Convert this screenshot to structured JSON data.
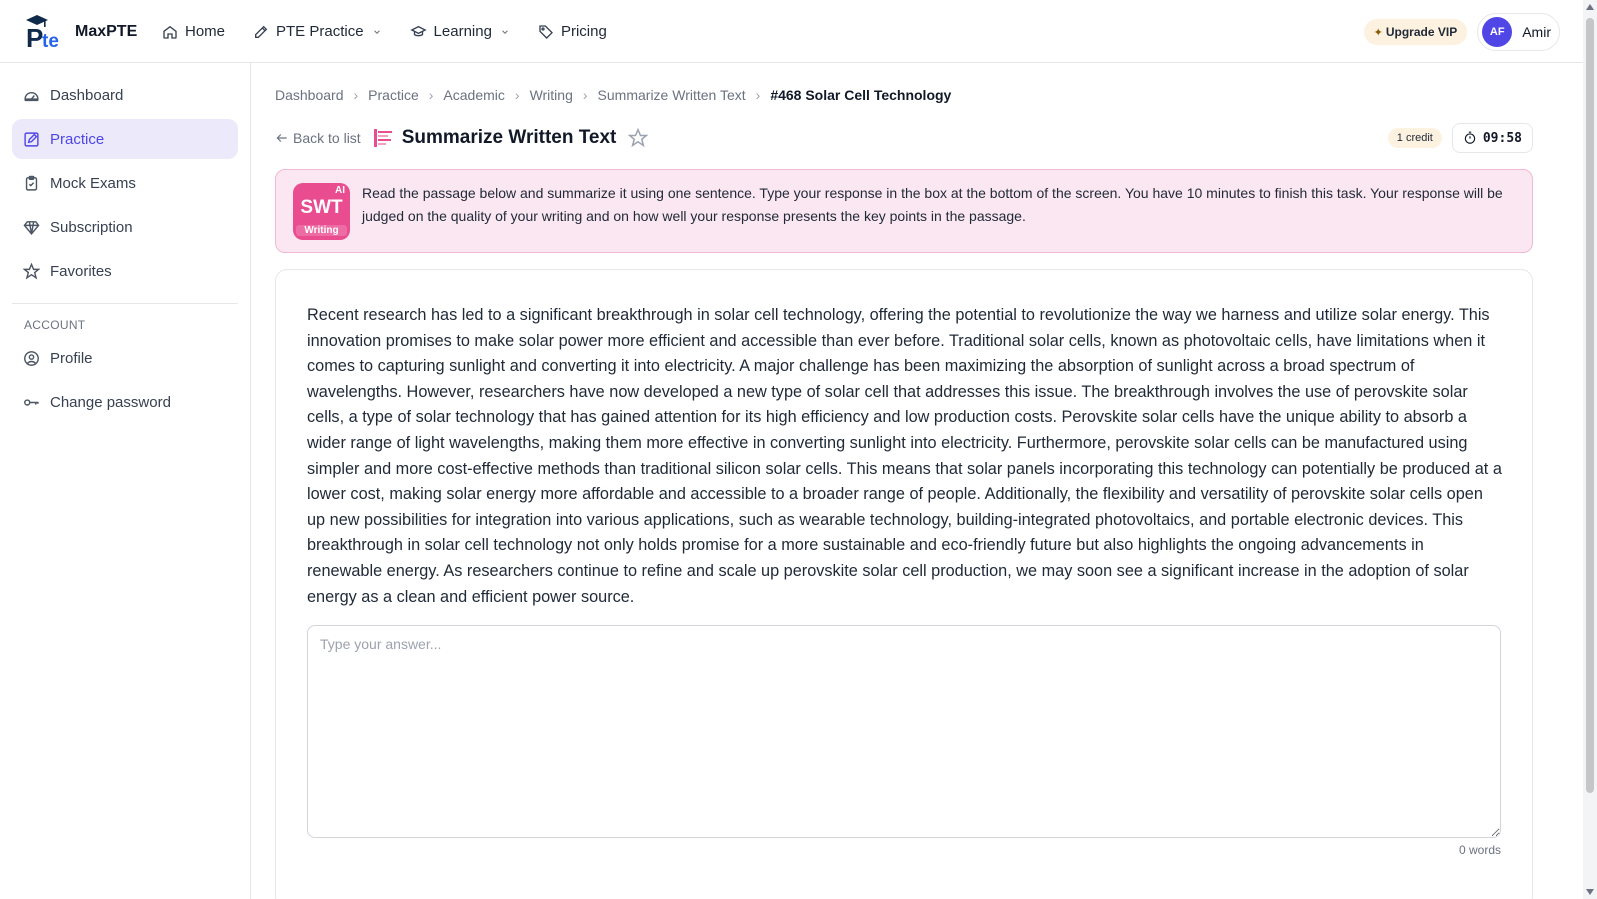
{
  "brand": {
    "name": "MaxPTE"
  },
  "nav": [
    {
      "label": "Home",
      "icon": "home-icon"
    },
    {
      "label": "PTE Practice",
      "icon": "edit-icon",
      "dropdown": true
    },
    {
      "label": "Learning",
      "icon": "graduation-cap-icon",
      "dropdown": true
    },
    {
      "label": "Pricing",
      "icon": "tag-icon"
    }
  ],
  "header": {
    "upgrade_label": "Upgrade VIP",
    "user_initials": "AF",
    "user_name": "Amir"
  },
  "sidebar": {
    "items": [
      {
        "label": "Dashboard",
        "icon": "gauge-icon"
      },
      {
        "label": "Practice",
        "icon": "edit-icon",
        "active": true
      },
      {
        "label": "Mock Exams",
        "icon": "clipboard-icon"
      },
      {
        "label": "Subscription",
        "icon": "diamond-icon"
      },
      {
        "label": "Favorites",
        "icon": "star-icon"
      }
    ],
    "account_heading": "ACCOUNT",
    "account_items": [
      {
        "label": "Profile",
        "icon": "user-circle-icon"
      },
      {
        "label": "Change password",
        "icon": "key-icon"
      }
    ]
  },
  "breadcrumb": [
    "Dashboard",
    "Practice",
    "Academic",
    "Writing",
    "Summarize Written Text",
    "#468 Solar Cell Technology"
  ],
  "task": {
    "back_label": "Back to list",
    "title": "Summarize Written Text",
    "credit": "1 credit",
    "timer": "09:58",
    "badge_ai": "AI",
    "badge_code": "SWT",
    "badge_category": "Writing",
    "instruction": "Read the passage below and summarize it using one sentence. Type your response in the box at the bottom of the screen. You have 10 minutes to finish this task. Your response will be judged on the quality of your writing and on how well your response presents the key points in the passage.",
    "passage": "Recent research has led to a significant breakthrough in solar cell technology, offering the potential to revolutionize the way we harness and utilize solar energy. This innovation promises to make solar power more efficient and accessible than ever before. Traditional solar cells, known as photovoltaic cells, have limitations when it comes to capturing sunlight and converting it into electricity. A major challenge has been maximizing the absorption of sunlight across a broad spectrum of wavelengths. However, researchers have now developed a new type of solar cell that addresses this issue. The breakthrough involves the use of perovskite solar cells, a type of solar technology that has gained attention for its high efficiency and low production costs. Perovskite solar cells have the unique ability to absorb a wider range of light wavelengths, making them more effective in converting sunlight into electricity. Furthermore, perovskite solar cells can be manufactured using simpler and more cost-effective methods than traditional silicon solar cells. This means that solar panels incorporating this technology can potentially be produced at a lower cost, making solar energy more affordable and accessible to a broader range of people. Additionally, the flexibility and versatility of perovskite solar cells open up new possibilities for integration into various applications, such as wearable technology, building-integrated photovoltaics, and portable electronic devices. This breakthrough in solar cell technology not only holds promise for a more sustainable and eco-friendly future but also highlights the ongoing advancements in renewable energy. As researchers continue to refine and scale up perovskite solar cell production, we may soon see a significant increase in the adoption of solar energy as a clean and efficient power source.",
    "answer_placeholder": "Type your answer...",
    "answer_value": "",
    "word_count": "0 words"
  },
  "colors": {
    "accent": "#4f46e5",
    "badge": "#e94c8f",
    "instruction_bg": "#fbe7f1",
    "vip_bg": "#fdf1e0"
  }
}
